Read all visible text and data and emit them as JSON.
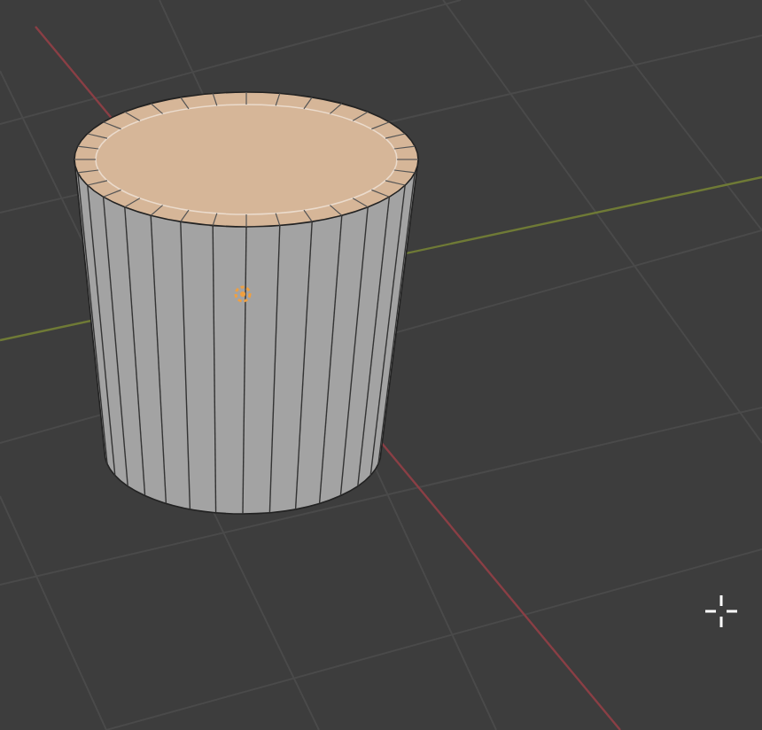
{
  "mesh": {
    "faces": [
      {
        "kind": "side",
        "selected": false
      },
      {
        "kind": "top",
        "selected": true
      }
    ]
  }
}
